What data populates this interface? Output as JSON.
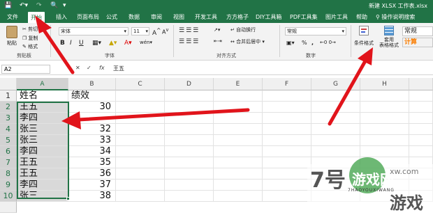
{
  "titlebar": {
    "doc_title": "新建 XLSX 工作表.xlsx",
    "colors": {
      "brand": "#217346"
    }
  },
  "tabs": [
    {
      "label": "文件"
    },
    {
      "label": "开始"
    },
    {
      "label": "插入"
    },
    {
      "label": "页面布局"
    },
    {
      "label": "公式"
    },
    {
      "label": "数据"
    },
    {
      "label": "审阅"
    },
    {
      "label": "视图"
    },
    {
      "label": "开发工具"
    },
    {
      "label": "方方格子"
    },
    {
      "label": "DIY工具箱"
    },
    {
      "label": "PDF工具集"
    },
    {
      "label": "图片工具"
    },
    {
      "label": "帮助"
    }
  ],
  "tell_me": "操作说明搜索",
  "ribbon": {
    "clipboard": {
      "paste": "粘贴",
      "cut": "剪切",
      "copy": "复制",
      "format": "格式",
      "label": "剪贴板"
    },
    "font": {
      "name": "宋体",
      "size": "11",
      "size_up": "A",
      "size_down": "A",
      "bold": "B",
      "italic": "I",
      "underline": "U",
      "wen": "wén",
      "font_color": "A",
      "label": "字体"
    },
    "alignment": {
      "wrap": "自动换行",
      "merge": "合并后居中",
      "label": "对齐方式"
    },
    "number": {
      "format": "常规",
      "label": "数字",
      "percent": "%",
      "comma": ","
    },
    "styles": {
      "conditional": "条件格式",
      "table": "套用\n表格格式",
      "normal": "常规",
      "calc": "计算"
    }
  },
  "formula_bar": {
    "name_box": "A2",
    "fx": "fx",
    "content": "王五"
  },
  "columns": [
    "A",
    "B",
    "C",
    "D",
    "E",
    "F",
    "G",
    "H"
  ],
  "rows": [
    {
      "num": "1",
      "a": "姓名",
      "b": "绩效"
    },
    {
      "num": "2",
      "a": "王五",
      "b": "30"
    },
    {
      "num": "3",
      "a": "李四",
      "b": ""
    },
    {
      "num": "4",
      "a": "张三",
      "b": "32"
    },
    {
      "num": "5",
      "a": "张三",
      "b": "33"
    },
    {
      "num": "6",
      "a": "李四",
      "b": "34"
    },
    {
      "num": "7",
      "a": "王五",
      "b": "35"
    },
    {
      "num": "8",
      "a": "王五",
      "b": "36"
    },
    {
      "num": "9",
      "a": "李四",
      "b": "37"
    },
    {
      "num": "10",
      "a": "张三",
      "b": "38"
    }
  ],
  "watermark": {
    "mark": "7号",
    "cn": "游戏网",
    "pinyin": "7HAOYOUXIWANG",
    "cn2": "游戏",
    "url": "xw.com"
  }
}
